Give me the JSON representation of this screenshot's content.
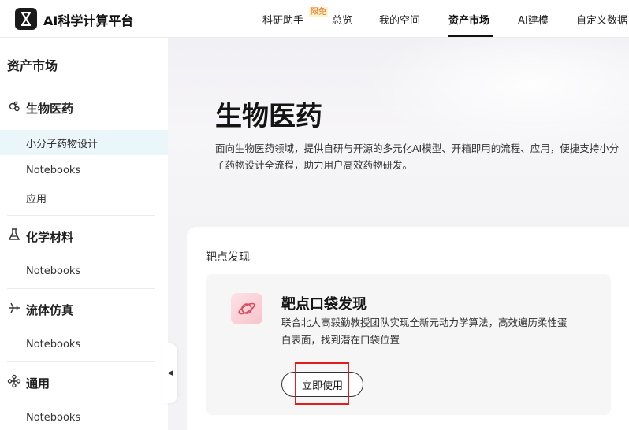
{
  "app": {
    "title": "AI科学计算平台"
  },
  "nav": {
    "items": [
      {
        "label": "科研助手",
        "badge": "限免"
      },
      {
        "label": "总览"
      },
      {
        "label": "我的空间"
      },
      {
        "label": "资产市场",
        "active": true
      },
      {
        "label": "AI建模"
      },
      {
        "label": "自定义数据"
      }
    ]
  },
  "sidebar": {
    "title": "资产市场",
    "categories": [
      {
        "label": "生物医药",
        "icon": "virus-icon",
        "items": [
          "小分子药物设计",
          "Notebooks",
          "应用"
        ],
        "active_item": 0
      },
      {
        "label": "化学材料",
        "icon": "flask-icon",
        "items": [
          "Notebooks"
        ]
      },
      {
        "label": "流体仿真",
        "icon": "airplane-icon",
        "items": [
          "Notebooks"
        ]
      },
      {
        "label": "通用",
        "icon": "network-icon",
        "items": [
          "Notebooks"
        ]
      }
    ]
  },
  "hero": {
    "title": "生物医药",
    "description": "面向生物医药领域，提供自研与开源的多元化AI模型、开箱即用的流程、应用，便捷支持小分子药物设计全流程，助力用户高效药物研发。"
  },
  "section": {
    "title": "靶点发现",
    "card": {
      "icon": "planet-icon",
      "title": "靶点口袋发现",
      "description": "联合北大高毅勤教授团队实现全新元动力学算法，高效遍历柔性蛋白表面，找到潜在口袋位置",
      "button_label": "立即使用"
    }
  },
  "colors": {
    "accent": "#111111",
    "badge": "#e26a2c",
    "active_bg": "#eaf6f9",
    "highlight": "#e11d1d"
  }
}
